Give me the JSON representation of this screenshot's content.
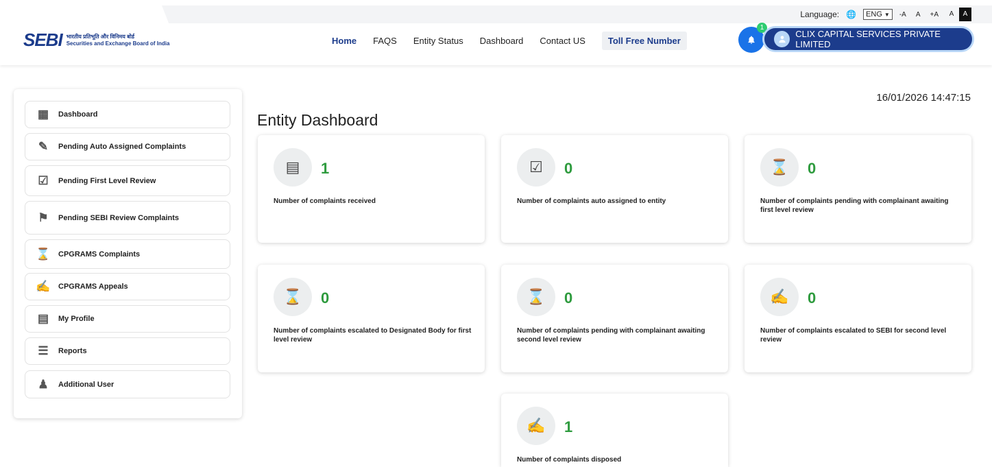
{
  "header": {
    "logo_mark": "SEBI",
    "logo_hindi": "भारतीय प्रतिभूति और विनिमय बोर्ड",
    "logo_english": "Securities and Exchange Board of India",
    "language_label": "Language:",
    "language_value": "ENG",
    "font_small": "-A",
    "font_normal": "A",
    "font_large": "+A",
    "contrast_light": "A",
    "contrast_dark": "A",
    "nav": [
      "Home",
      "FAQS",
      "Entity Status",
      "Dashboard",
      "Contact US"
    ],
    "toll_free": "Toll Free Number",
    "notification_count": "1",
    "user_name": "CLIX CAPITAL SERVICES PRIVATE LIMITED"
  },
  "sidebar": {
    "items": [
      {
        "label": "Dashboard",
        "icon": "dashboard-icon"
      },
      {
        "label": "Pending Auto Assigned Complaints",
        "icon": "document-edit-icon"
      },
      {
        "label": "Pending First Level Review",
        "icon": "document-check-icon"
      },
      {
        "label": "Pending SEBI Review Complaints",
        "icon": "presenter-icon"
      },
      {
        "label": "CPGRAMS Complaints",
        "icon": "document-hourglass-icon"
      },
      {
        "label": "CPGRAMS Appeals",
        "icon": "appeal-icon"
      },
      {
        "label": "My Profile",
        "icon": "profile-card-icon"
      },
      {
        "label": "Reports",
        "icon": "report-icon"
      },
      {
        "label": "Additional User",
        "icon": "users-icon"
      }
    ]
  },
  "main": {
    "timestamp": "16/01/2026 14:47:15",
    "title": "Entity Dashboard",
    "cards": [
      {
        "count": "1",
        "label": "Number of complaints received",
        "icon": "complaint-received-icon"
      },
      {
        "count": "0",
        "label": "Number of complaints auto assigned to entity",
        "icon": "auto-assigned-icon"
      },
      {
        "count": "0",
        "label": "Number of complaints pending with complainant awaiting first level review",
        "icon": "pending-first-level-icon"
      },
      {
        "count": "0",
        "label": "Number of complaints escalated to Designated Body for first level review",
        "icon": "escalated-designated-icon"
      },
      {
        "count": "0",
        "label": "Number of complaints pending with complainant awaiting second level review",
        "icon": "pending-second-level-icon"
      },
      {
        "count": "0",
        "label": "Number of complaints escalated to SEBI for second level review",
        "icon": "escalated-sebi-icon"
      },
      {
        "count": "1",
        "label": "Number of complaints disposed",
        "icon": "disposed-icon"
      }
    ]
  },
  "colors": {
    "brand": "#1c3c8c",
    "accent": "#1a73e8",
    "count_green": "#2e9b3e"
  }
}
